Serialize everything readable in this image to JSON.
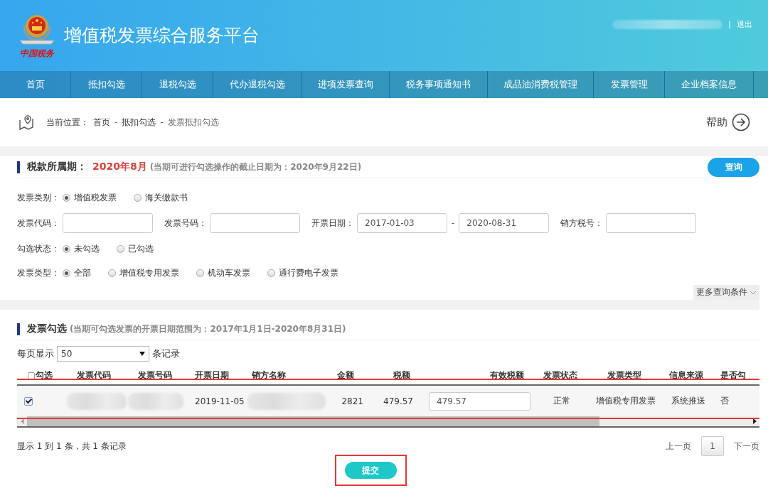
{
  "header": {
    "logo_text": "中国税务",
    "title": "增值税发票综合服务平台",
    "user_redacted": true,
    "separator": "|",
    "logout": "退出"
  },
  "nav": {
    "items": [
      "首页",
      "抵扣勾选",
      "退税勾选",
      "代办退税勾选",
      "进项发票查询",
      "税务事项通知书",
      "成品油消费税管理",
      "发票管理",
      "企业档案信息"
    ]
  },
  "breadcrumb": {
    "label": "当前位置：",
    "items": [
      "首页",
      "抵扣勾选",
      "发票抵扣勾选"
    ],
    "separator": "-",
    "help": "帮助"
  },
  "period": {
    "title": "税款所属期：",
    "value": "2020年8月",
    "note": "(当期可进行勾选操作的截止日期为：2020年9月22日)",
    "button": "查询"
  },
  "filters": [
    {
      "kind": "radio",
      "label": "发票类别：",
      "options": [
        {
          "label": "增值税发票",
          "selected": true
        },
        {
          "label": "海关缴款书",
          "selected": false
        }
      ]
    },
    {
      "kind": "inputs",
      "fields": [
        {
          "label": "发票代码："
        },
        {
          "label": "发票号码："
        },
        {
          "label": "开票日期：",
          "value": "2017-01-03",
          "range_separator": "-",
          "value_to": "2020-08-31"
        },
        {
          "label": "销方税号："
        }
      ]
    },
    {
      "kind": "radio",
      "label": "勾选状态：",
      "options": [
        {
          "label": "未勾选",
          "selected": true
        },
        {
          "label": "已勾选",
          "selected": false
        }
      ]
    },
    {
      "kind": "radio",
      "label": "发票类型：",
      "options": [
        {
          "label": "全部",
          "selected": true
        },
        {
          "label": "增值税专用发票",
          "selected": false
        },
        {
          "label": "机动车发票",
          "selected": false
        },
        {
          "label": "通行费电子发票",
          "selected": false
        }
      ]
    }
  ],
  "more_conditions": "更多查询条件",
  "invoices": {
    "title": "发票勾选",
    "note": "(当期可勾选发票的开票日期范围为：2017年1月1日-2020年8月31日)",
    "page_size_label": "每页显示",
    "page_size": "50",
    "page_size_suffix": "条记录",
    "table": {
      "select_all_checked": false,
      "columns": [
        "勾选",
        "发票代码",
        "发票号码",
        "开票日期",
        "销方名称",
        "金额",
        "税额",
        "有效税额",
        "发票状态",
        "发票类型",
        "信息来源",
        "是否勾"
      ],
      "rows": [
        {
          "highlighted": true,
          "cells": [
            {
              "kind": "checkbox",
              "checked": true
            },
            {
              "kind": "redacted"
            },
            {
              "kind": "redacted"
            },
            {
              "kind": "text",
              "text": "2019-11-05"
            },
            {
              "kind": "redacted"
            },
            {
              "kind": "text",
              "text": "2821"
            },
            {
              "kind": "text",
              "text": "479.57"
            },
            {
              "kind": "input",
              "value": "479.57"
            },
            {
              "kind": "text",
              "text": "正常"
            },
            {
              "kind": "text",
              "text": "增值税专用发票"
            },
            {
              "kind": "text",
              "text": "系统推送"
            },
            {
              "kind": "text",
              "text": "否"
            }
          ]
        }
      ]
    },
    "summary": "显示 1 到 1 条，共 1 条记录",
    "pagination": {
      "prev": "上一页",
      "pages": [
        {
          "label": "1",
          "selected": true
        }
      ],
      "next": "下一页"
    },
    "submit": {
      "label": "提交",
      "highlighted": true
    }
  }
}
